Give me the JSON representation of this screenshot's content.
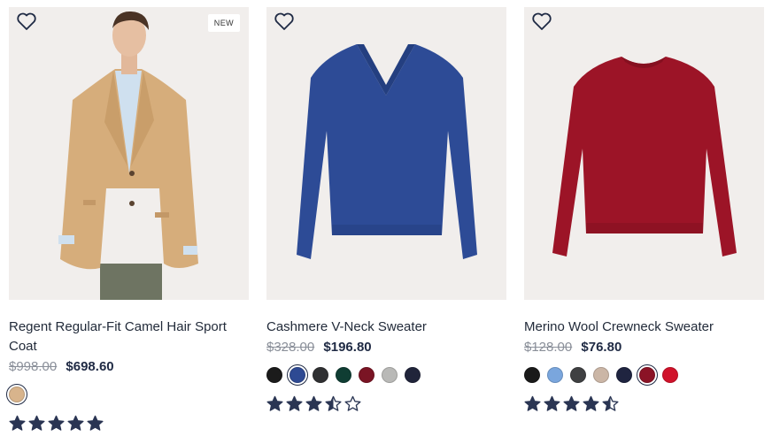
{
  "products": [
    {
      "name": "Regent Regular-Fit Camel Hair Sport Coat",
      "badge": "NEW",
      "price_original": "$998.00",
      "price_sale": "$698.60",
      "swatches": [
        {
          "color": "#d8b48c",
          "selected": true
        }
      ],
      "rating": 5,
      "image": "camel-sport-coat-image"
    },
    {
      "name": "Cashmere V-Neck Sweater",
      "badge": "",
      "price_original": "$328.00",
      "price_sale": "$196.80",
      "swatches": [
        {
          "color": "#1b1b1b",
          "selected": false
        },
        {
          "color": "#2e4a93",
          "selected": true
        },
        {
          "color": "#2f3032",
          "selected": false
        },
        {
          "color": "#0f3d33",
          "selected": false
        },
        {
          "color": "#7a1424",
          "selected": false
        },
        {
          "color": "#b9b9b7",
          "selected": false
        },
        {
          "color": "#20243a",
          "selected": false
        }
      ],
      "rating": 3.5,
      "image": "blue-vneck-sweater-image"
    },
    {
      "name": "Merino Wool Crewneck Sweater",
      "badge": "",
      "price_original": "$128.00",
      "price_sale": "$76.80",
      "swatches": [
        {
          "color": "#1a1a1a",
          "selected": false
        },
        {
          "color": "#7aa6dd",
          "selected": false
        },
        {
          "color": "#3f4042",
          "selected": false
        },
        {
          "color": "#cbb6a6",
          "selected": false
        },
        {
          "color": "#1f2440",
          "selected": false
        },
        {
          "color": "#8b1326",
          "selected": true
        },
        {
          "color": "#d0122a",
          "selected": false
        }
      ],
      "rating": 4.5,
      "image": "red-crewneck-sweater-image"
    }
  ],
  "colors": {
    "star": "#2a3553",
    "text": "#1f2a44",
    "muted": "#8a8f99",
    "image_bg": "#f2eeec"
  }
}
